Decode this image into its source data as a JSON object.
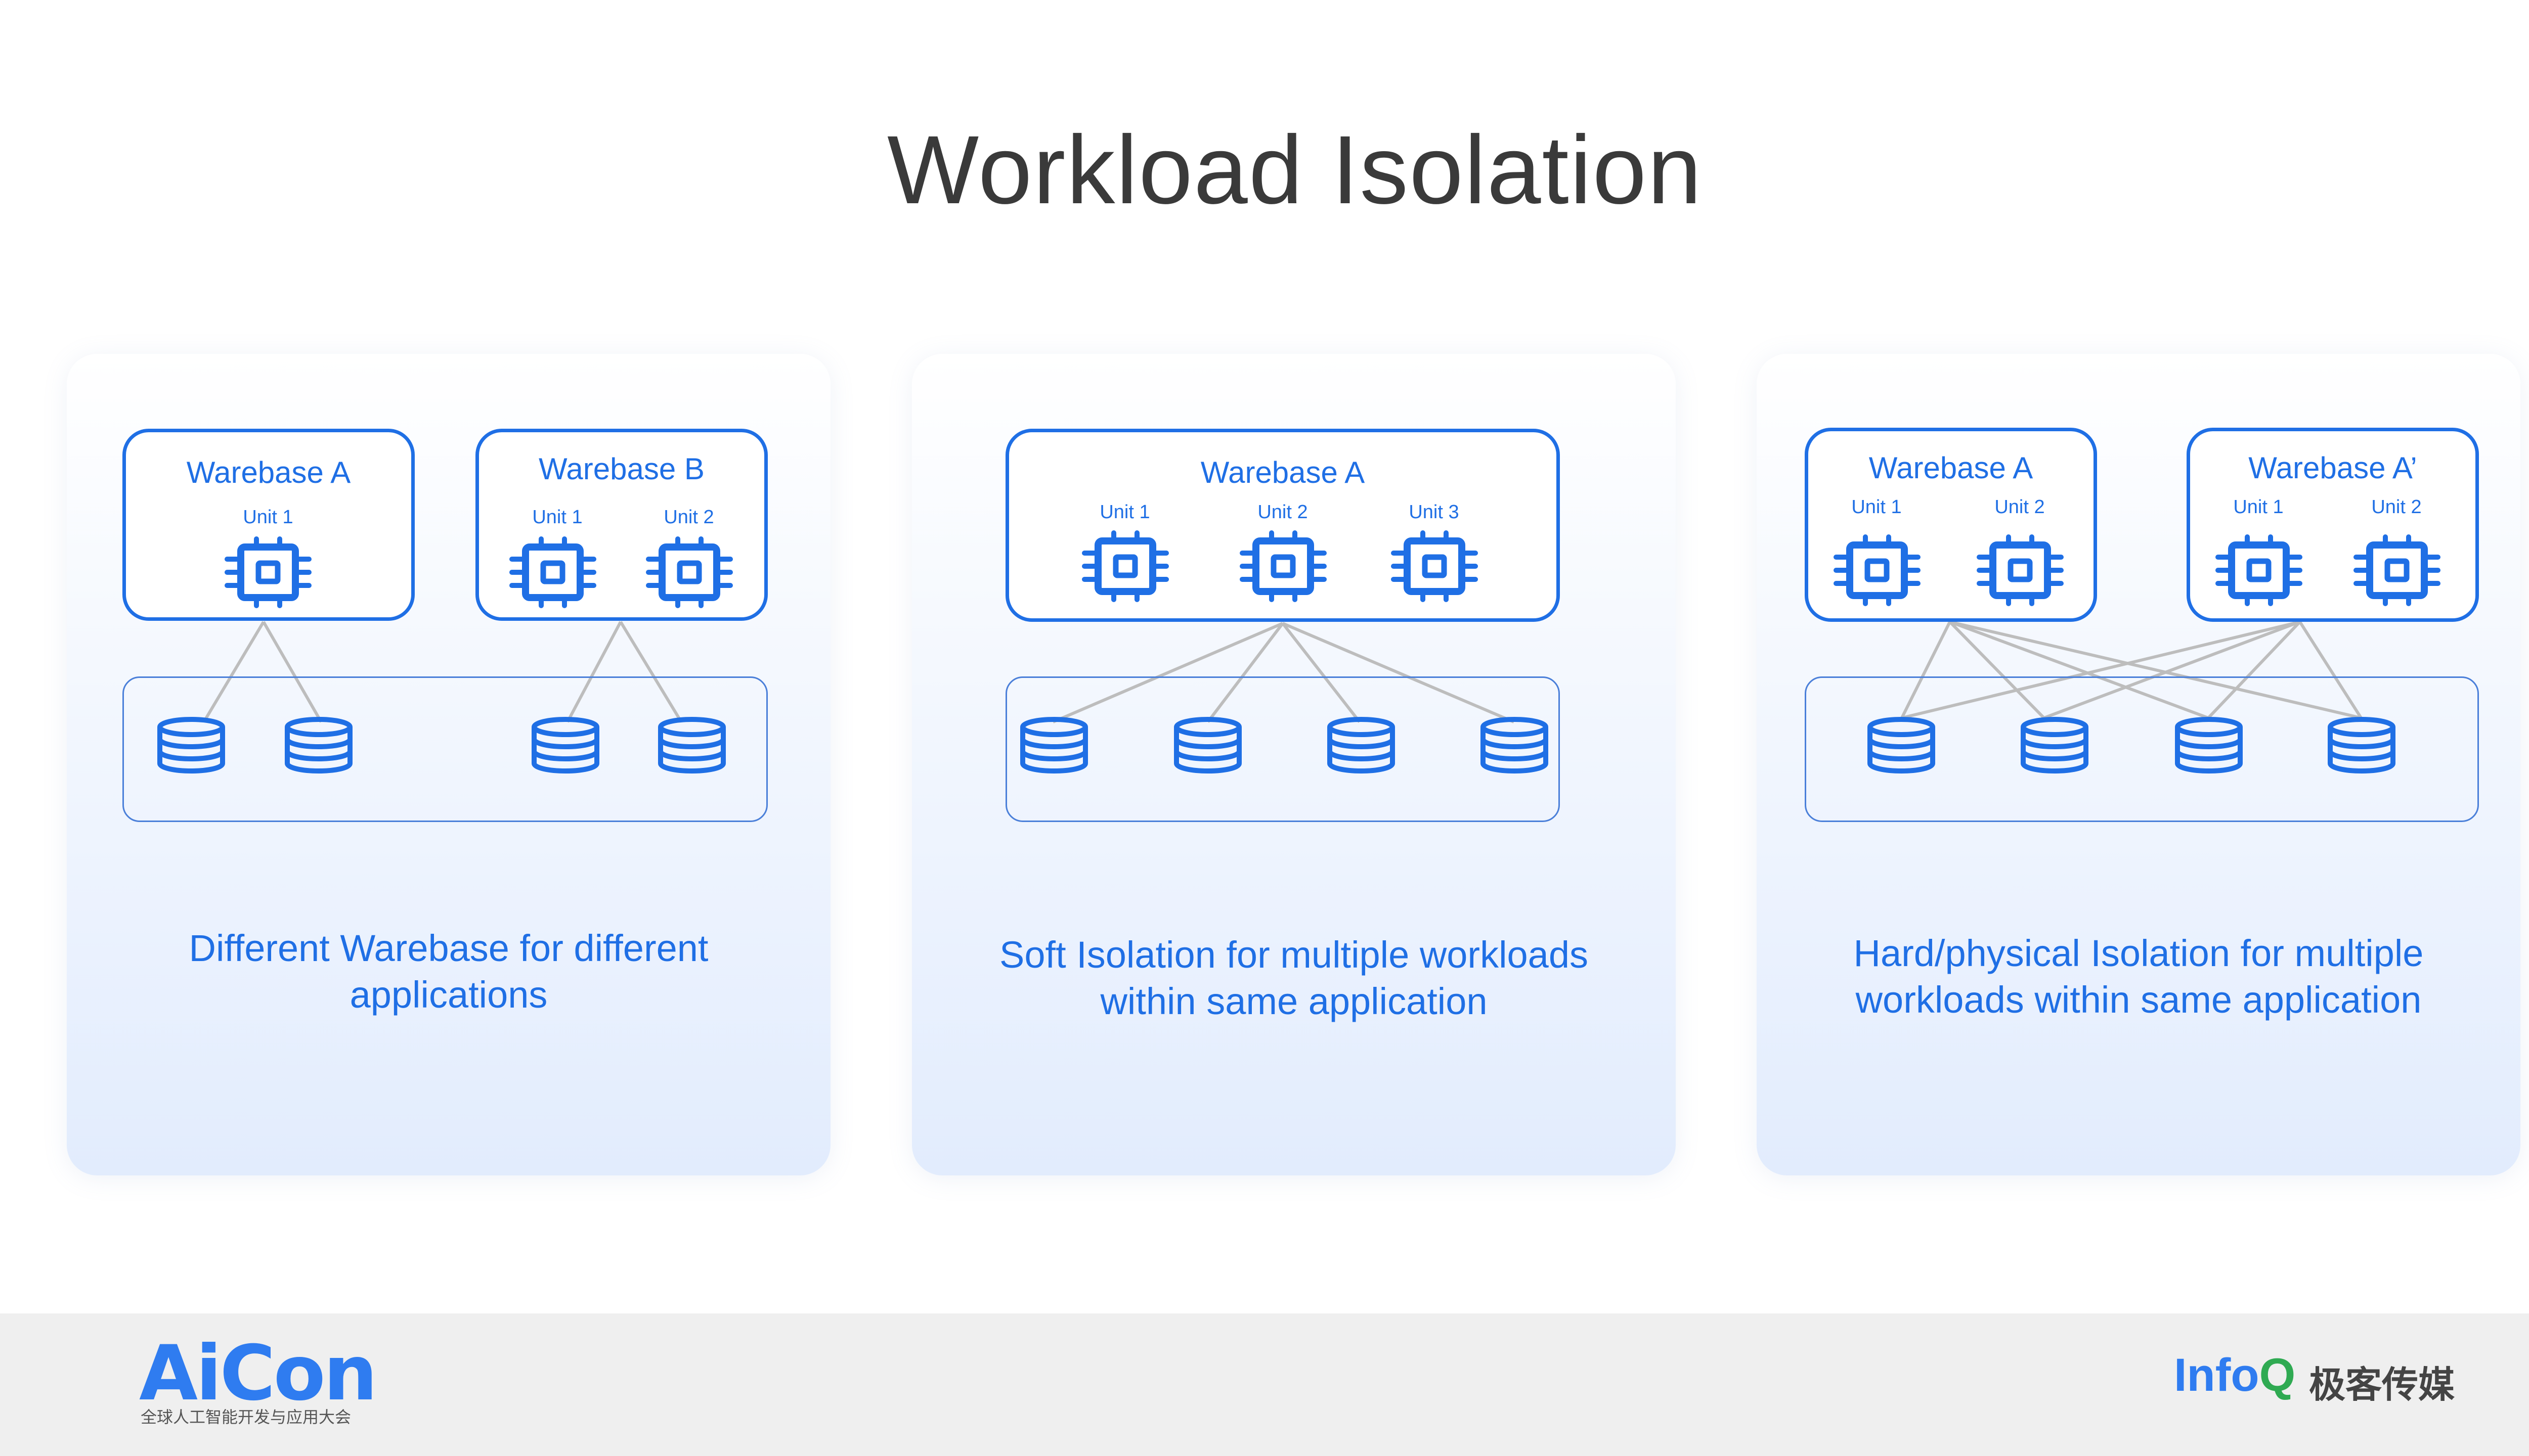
{
  "title": "Workload Isolation",
  "colors": {
    "accent": "#1f6fe5",
    "link_line": "#bdbdbd",
    "title_text": "#3a3a3a",
    "footer_bg": "#efefef"
  },
  "icons": {
    "compute_unit": "cpu-chip-icon",
    "storage": "database-icon"
  },
  "panels": [
    {
      "warebases": [
        {
          "name": "Warebase A",
          "units": [
            "Unit 1"
          ]
        },
        {
          "name": "Warebase B",
          "units": [
            "Unit 1",
            "Unit 2"
          ]
        }
      ],
      "caption_line1": "Different Warebase for different",
      "caption_line2": "applications"
    },
    {
      "warebases": [
        {
          "name": "Warebase A",
          "units": [
            "Unit 1",
            "Unit 2",
            "Unit 3"
          ]
        }
      ],
      "caption_line1": "Soft Isolation for multiple workloads",
      "caption_line2": "within same application"
    },
    {
      "warebases": [
        {
          "name": "Warebase A",
          "units": [
            "Unit 1",
            "Unit 2"
          ]
        },
        {
          "name": "Warebase A’",
          "units": [
            "Unit 1",
            "Unit 2"
          ]
        }
      ],
      "caption_line1": "Hard/physical Isolation for multiple",
      "caption_line2": "workloads within same application"
    }
  ],
  "footer": {
    "aicon_logo": "AiCon",
    "aicon_tagline": "全球人工智能开发与应用大会",
    "infoq_logo_main": "Info",
    "infoq_logo_q": "Q",
    "geek_media": "极客传媒"
  }
}
